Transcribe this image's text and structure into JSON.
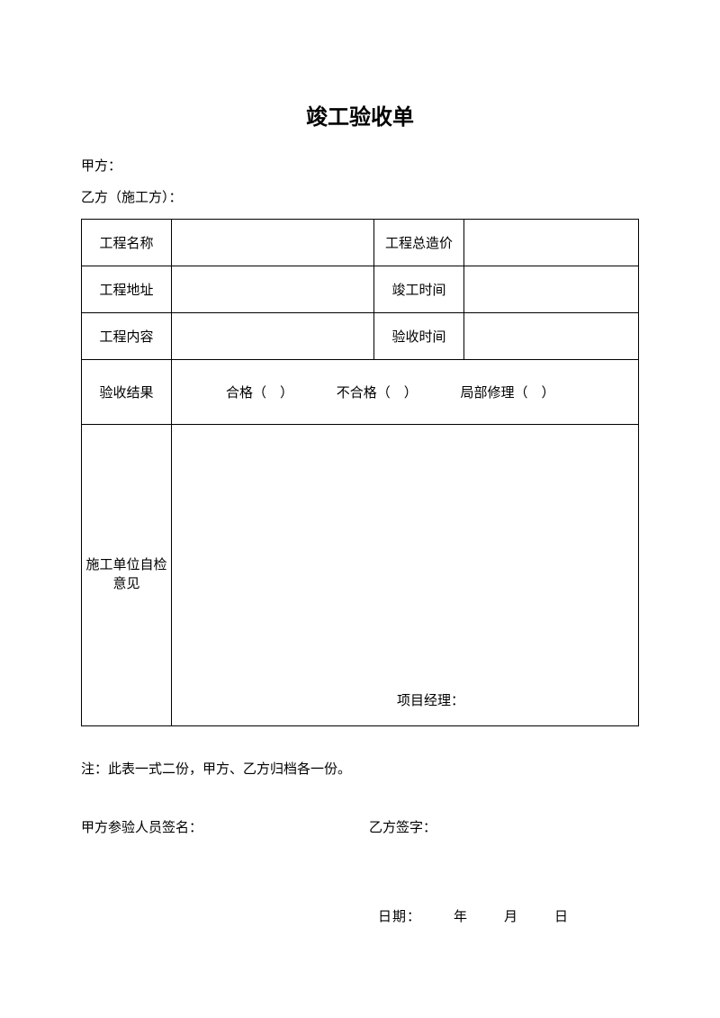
{
  "title": "竣工验收单",
  "parties": {
    "party_a_label": "甲方：",
    "party_b_label": "乙方（施工方）："
  },
  "table": {
    "row1": {
      "label_left": "工程名称",
      "value_left": "",
      "label_right": "工程总造价",
      "value_right": ""
    },
    "row2": {
      "label_left": "工程地址",
      "value_left": "",
      "label_right": "竣工时间",
      "value_right": ""
    },
    "row3": {
      "label_left": "工程内容",
      "value_left": "",
      "label_right": "验收时间",
      "value_right": ""
    },
    "result": {
      "label": "验收结果",
      "option1": "合格（　）",
      "option2": "不合格（　）",
      "option3": "局部修理（　）"
    },
    "self_check": {
      "label": "施工单位自检意见",
      "pm_label": "项目经理："
    }
  },
  "note": "注：此表一式二份，甲方、乙方归档各一份。",
  "signatures": {
    "party_a_sign": "甲方参验人员签名：",
    "party_b_sign": "乙方签字："
  },
  "date": {
    "label": "日期：",
    "year": "年",
    "month": "月",
    "day": "日"
  }
}
